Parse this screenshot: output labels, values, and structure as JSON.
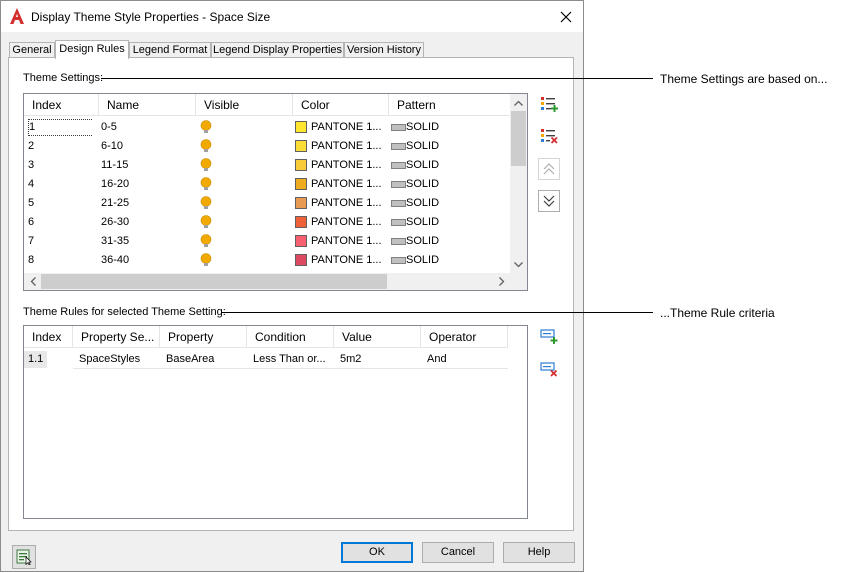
{
  "window": {
    "title": "Display Theme Style Properties - Space Size",
    "close_glyph": "✕"
  },
  "tabs": [
    {
      "label": "General",
      "active": false
    },
    {
      "label": "Design Rules",
      "active": true
    },
    {
      "label": "Legend Format",
      "active": false
    },
    {
      "label": "Legend Display Properties",
      "active": false
    },
    {
      "label": "Version History",
      "active": false
    }
  ],
  "theme_settings": {
    "label": "Theme Settings:",
    "columns": [
      "Index",
      "Name",
      "Visible",
      "Color",
      "Pattern"
    ],
    "rows": [
      {
        "index": "1",
        "name": "0-5",
        "color_name": "PANTONE 1...",
        "color": "#ffe52e",
        "pattern": "SOLID",
        "selected": true
      },
      {
        "index": "2",
        "name": "6-10",
        "color_name": "PANTONE 1...",
        "color": "#fddd35",
        "pattern": "SOLID",
        "selected": false
      },
      {
        "index": "3",
        "name": "11-15",
        "color_name": "PANTONE 1...",
        "color": "#f8cc38",
        "pattern": "SOLID",
        "selected": false
      },
      {
        "index": "4",
        "name": "16-20",
        "color_name": "PANTONE 1...",
        "color": "#eeab1f",
        "pattern": "SOLID",
        "selected": false
      },
      {
        "index": "5",
        "name": "21-25",
        "color_name": "PANTONE 1...",
        "color": "#e79a52",
        "pattern": "SOLID",
        "selected": false
      },
      {
        "index": "6",
        "name": "26-30",
        "color_name": "PANTONE 1...",
        "color": "#ef6139",
        "pattern": "SOLID",
        "selected": false
      },
      {
        "index": "7",
        "name": "31-35",
        "color_name": "PANTONE 1...",
        "color": "#f76070",
        "pattern": "SOLID",
        "selected": false
      },
      {
        "index": "8",
        "name": "36-40",
        "color_name": "PANTONE 1...",
        "color": "#dd4960",
        "pattern": "SOLID",
        "selected": false
      }
    ]
  },
  "theme_rules": {
    "label": "Theme Rules for selected Theme Setting:",
    "columns": [
      "Index",
      "Property Se...",
      "Property",
      "Condition",
      "Value",
      "Operator"
    ],
    "rows": [
      {
        "index": "1.1",
        "property_set": "SpaceStyles",
        "property": "BaseArea",
        "condition": "Less Than or...",
        "value": "5m2",
        "operator": "And"
      }
    ]
  },
  "buttons": {
    "ok": "OK",
    "cancel": "Cancel",
    "help": "Help"
  },
  "annotations": {
    "theme_settings_note": "Theme Settings are based on...",
    "theme_rules_note": "...Theme Rule criteria"
  },
  "colors": {
    "bulb": "#f2a900",
    "accent": "#0078d7"
  }
}
